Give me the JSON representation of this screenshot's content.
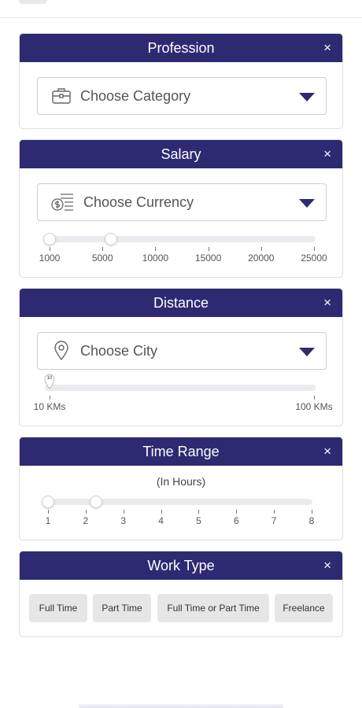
{
  "profession": {
    "title": "Profession",
    "close": "×",
    "select_placeholder": "Choose Category",
    "icon": "briefcase-icon"
  },
  "salary": {
    "title": "Salary",
    "close": "×",
    "select_placeholder": "Choose Currency",
    "icon": "currency-icon",
    "range": {
      "min": 1000,
      "max": 25000,
      "low": 1000,
      "high": 5000
    },
    "ticks": [
      "1000",
      "5000",
      "10000",
      "15000",
      "20000",
      "25000"
    ]
  },
  "distance": {
    "title": "Distance",
    "close": "×",
    "select_placeholder": "Choose City",
    "icon": "location-pin-icon",
    "value_badge": "10",
    "range": {
      "min": 10,
      "max": 100,
      "value": 10
    },
    "ticks": [
      "10 KMs",
      "100 KMs"
    ]
  },
  "time_range": {
    "title": "Time Range",
    "close": "×",
    "subtitle": "(In Hours)",
    "range": {
      "min": 1,
      "max": 8,
      "low": 1,
      "high": 2
    },
    "ticks": [
      "1",
      "2",
      "3",
      "4",
      "5",
      "6",
      "7",
      "8"
    ]
  },
  "work_type": {
    "title": "Work Type",
    "close": "×",
    "options": [
      "Full Time",
      "Part Time",
      "Full Time or Part Time",
      "Freelance"
    ]
  },
  "colors": {
    "header": "#2e2a72",
    "caret": "#2e2a72",
    "chip": "#e6e6e6"
  }
}
